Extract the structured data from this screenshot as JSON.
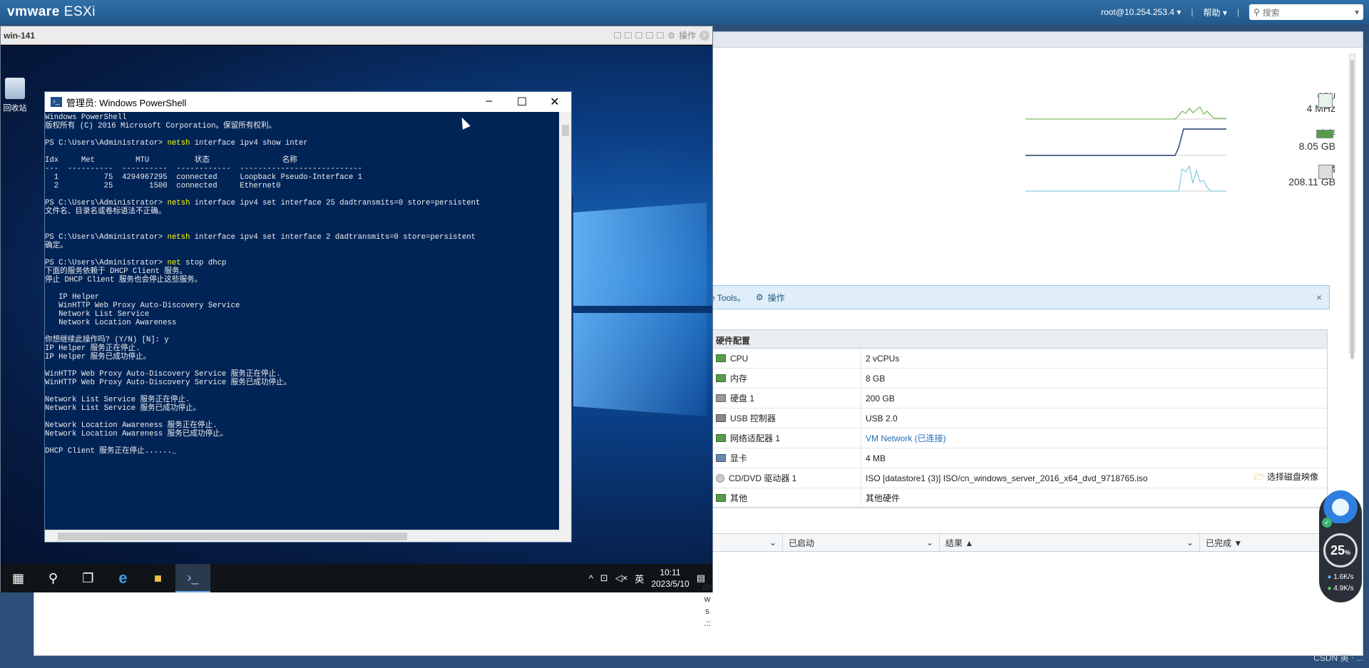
{
  "esxi": {
    "logo": "vmware",
    "product": "ESXi",
    "user": "root@10.254.253.4 ▾",
    "help": "帮助 ▾",
    "search_placeholder": "搜索",
    "metrics": [
      {
        "label": "CPU",
        "value": "4 MHz"
      },
      {
        "label": "内存",
        "value": "8.05 GB"
      },
      {
        "label": "存储",
        "value": "208.11 GB"
      }
    ],
    "notice_text": "e Tools。",
    "notice_action": "操作",
    "hardware": {
      "title": "硬件配置",
      "rows": [
        {
          "key": "CPU",
          "value": "2 vCPUs"
        },
        {
          "key": "内存",
          "value": "8 GB"
        },
        {
          "key": "硬盘 1",
          "value": "200 GB"
        },
        {
          "key": "USB 控制器",
          "value": "USB 2.0"
        },
        {
          "key": "网络适配器 1",
          "value": "VM Network (已连接)"
        },
        {
          "key": "显卡",
          "value": "4 MB"
        },
        {
          "key": "CD/DVD 驱动器 1",
          "value": "ISO [datastore1 (3)] ISO/cn_windows_server_2016_x64_dvd_9718765.iso",
          "action": "选择磁盘映像"
        },
        {
          "key": "其他",
          "value": "其他硬件"
        }
      ]
    },
    "tasks": {
      "columns": [
        "",
        "已启动",
        "结果 ▲",
        "已完成 ▼"
      ]
    },
    "side_text": [
      "do",
      "w",
      "s",
      ".::"
    ]
  },
  "vm": {
    "title": "win-141",
    "action": "操作",
    "recycle_bin": "回收站",
    "taskbar": {
      "time": "10:11",
      "date": "2023/5/10",
      "ime": "英"
    }
  },
  "powershell": {
    "title": "管理员: Windows PowerShell",
    "lines": [
      {
        "t": "Windows PowerShell"
      },
      {
        "t": "版权所有 (C) 2016 Microsoft Corporation。保留所有权利。"
      },
      {
        "t": ""
      },
      {
        "p": "PS C:\\Users\\Administrator> ",
        "c": "netsh",
        "r": " interface ipv4 show inter"
      },
      {
        "t": ""
      },
      {
        "t": "Idx     Met         MTU          状态                名称"
      },
      {
        "t": "---  ----------  ----------  ------------  ---------------------------"
      },
      {
        "t": "  1          75  4294967295  connected     Loopback Pseudo-Interface 1"
      },
      {
        "t": "  2          25        1500  connected     Ethernet0"
      },
      {
        "t": ""
      },
      {
        "p": "PS C:\\Users\\Administrator> ",
        "c": "netsh",
        "r": " interface ipv4 set interface 25 dadtransmits=0 store=persistent"
      },
      {
        "t": "文件名、目录名或卷标语法不正确。"
      },
      {
        "t": ""
      },
      {
        "t": ""
      },
      {
        "p": "PS C:\\Users\\Administrator> ",
        "c": "netsh",
        "r": " interface ipv4 set interface 2 dadtransmits=0 store=persistent"
      },
      {
        "t": "确定。"
      },
      {
        "t": ""
      },
      {
        "p": "PS C:\\Users\\Administrator> ",
        "c": "net",
        "r": " stop dhcp"
      },
      {
        "t": "下面的服务依赖于 DHCP Client 服务。"
      },
      {
        "t": "停止 DHCP Client 服务也会停止这些服务。"
      },
      {
        "t": ""
      },
      {
        "t": "   IP Helper"
      },
      {
        "t": "   WinHTTP Web Proxy Auto-Discovery Service"
      },
      {
        "t": "   Network List Service"
      },
      {
        "t": "   Network Location Awareness"
      },
      {
        "t": ""
      },
      {
        "t": "你想继续此操作吗? (Y/N) [N]: y"
      },
      {
        "t": "IP Helper 服务正在停止."
      },
      {
        "t": "IP Helper 服务已成功停止。"
      },
      {
        "t": ""
      },
      {
        "t": "WinHTTP Web Proxy Auto-Discovery Service 服务正在停止."
      },
      {
        "t": "WinHTTP Web Proxy Auto-Discovery Service 服务已成功停止。"
      },
      {
        "t": ""
      },
      {
        "t": "Network List Service 服务正在停止."
      },
      {
        "t": "Network List Service 服务已成功停止。"
      },
      {
        "t": ""
      },
      {
        "t": "Network Location Awareness 服务正在停止."
      },
      {
        "t": "Network Location Awareness 服务已成功停止。"
      },
      {
        "t": ""
      },
      {
        "t": "DHCP Client 服务正在停止......_"
      }
    ]
  },
  "netmon": {
    "percent": "25",
    "percent_unit": "%",
    "up": "1.6K/s",
    "down": "4.9K/s"
  },
  "watermark": "CSDN 英 ⋅ ..."
}
